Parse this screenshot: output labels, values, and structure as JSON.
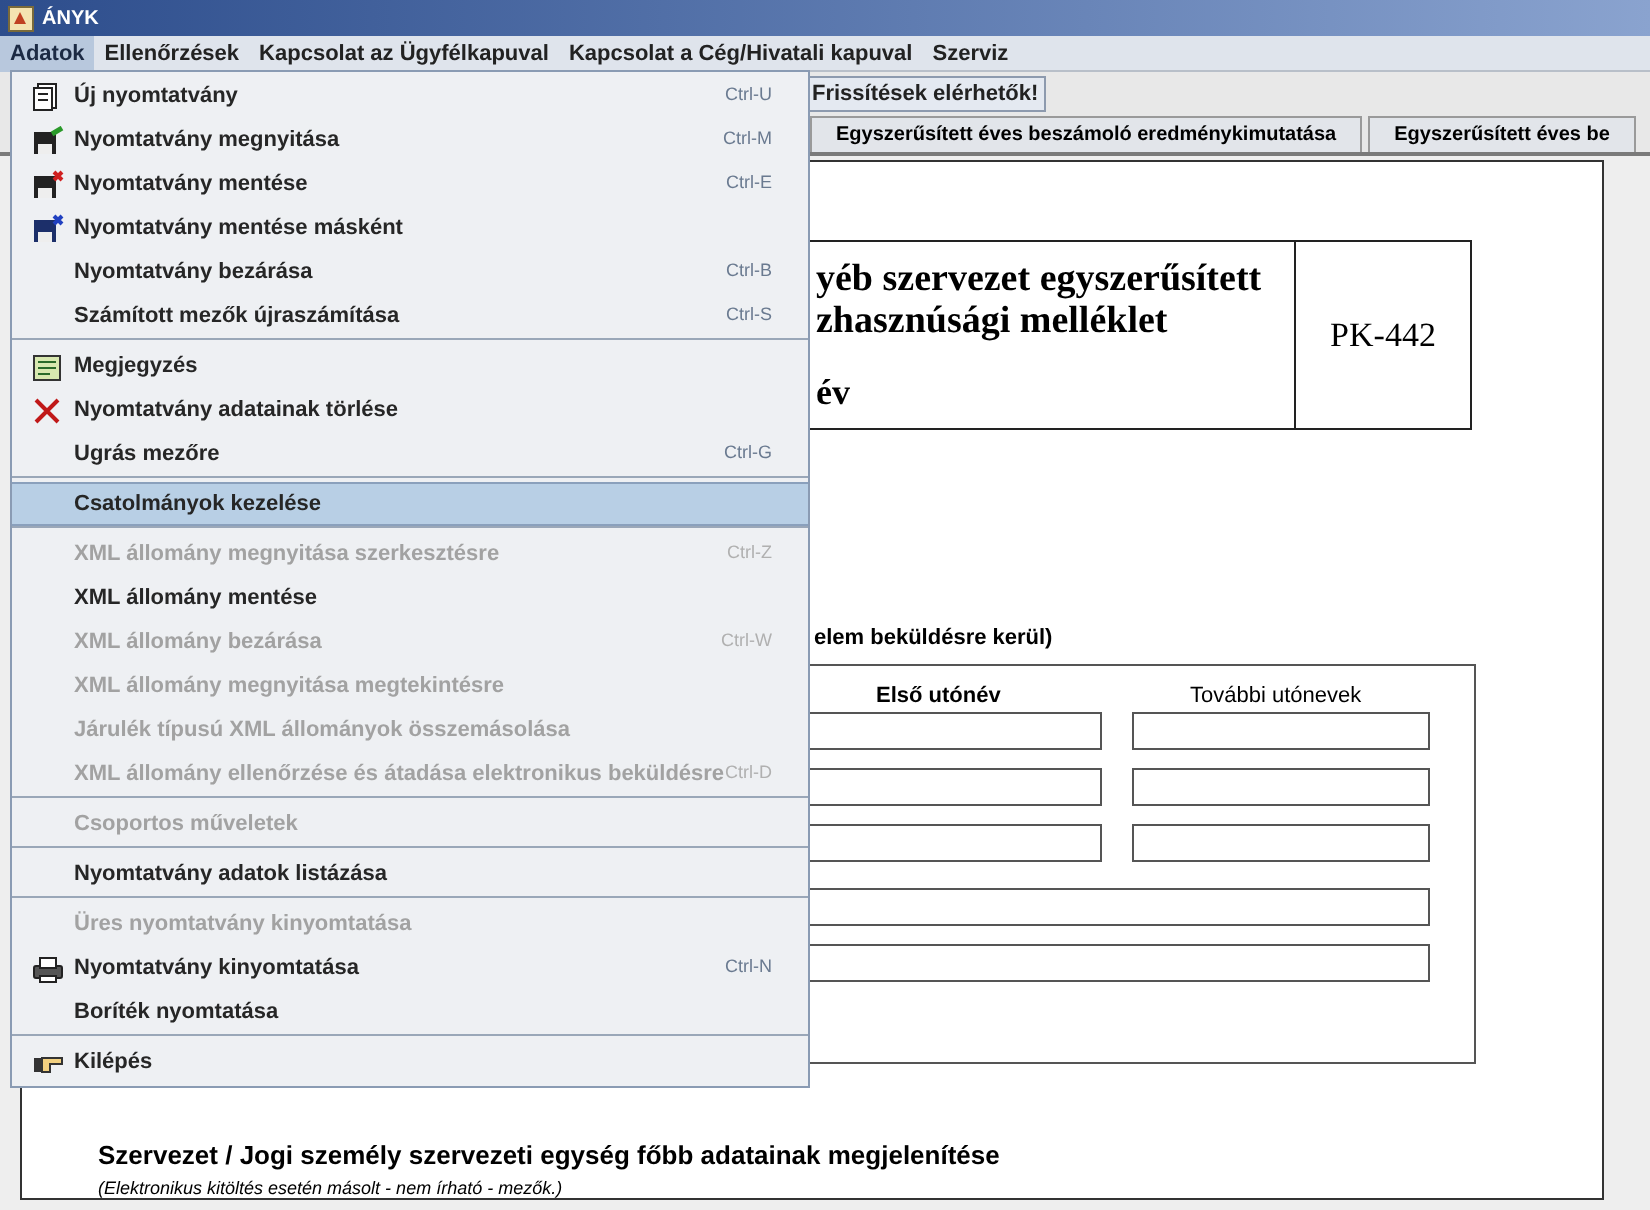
{
  "window": {
    "title": "ÁNYK"
  },
  "menu_bar": [
    {
      "label": "Adatok",
      "selected": true
    },
    {
      "label": "Ellenőrzések",
      "selected": false
    },
    {
      "label": "Kapcsolat az Ügyfélkapuval",
      "selected": false
    },
    {
      "label": "Kapcsolat a Cég/Hivatali kapuval",
      "selected": false
    },
    {
      "label": "Szerviz",
      "selected": false
    }
  ],
  "toolbar": {
    "update_button": "Frissítések elérhetők!"
  },
  "tabs": [
    {
      "label": "Egyszerűsített éves beszámoló eredménykimutatása",
      "selected": false
    },
    {
      "label": "Egyszerűsített éves be",
      "selected": false
    }
  ],
  "form": {
    "header_lines": [
      "yéb szervezet egyszerűsített",
      "zhasznúsági melléklet"
    ],
    "year_label": "év",
    "code": "PK-442",
    "section_note": "elem beküldésre kerül)",
    "name_columns": [
      {
        "label": "Első utónév",
        "emphasized": true
      },
      {
        "label": "További utónevek",
        "emphasized": false
      }
    ],
    "section_title": "Szervezet / Jogi személy szervezeti egység főbb adatainak megjelenítése",
    "section_subtitle": "(Elektronikus kitöltés esetén másolt - nem írható -  mezők.)"
  },
  "dropdown_menu": {
    "items": [
      {
        "kind": "item",
        "label": "Új nyomtatvány",
        "shortcut": "Ctrl-U",
        "disabled": false,
        "selected": false
      },
      {
        "kind": "item",
        "label": "Nyomtatvány megnyitása",
        "shortcut": "Ctrl-M",
        "disabled": false,
        "selected": false
      },
      {
        "kind": "item",
        "label": "Nyomtatvány mentése",
        "shortcut": "Ctrl-E",
        "disabled": false,
        "selected": false
      },
      {
        "kind": "item",
        "label": "Nyomtatvány mentése másként",
        "disabled": false,
        "selected": false
      },
      {
        "kind": "item",
        "label": "Nyomtatvány bezárása",
        "shortcut": "Ctrl-B",
        "disabled": false,
        "selected": false
      },
      {
        "kind": "item",
        "label": "Számított mezők újraszámítása",
        "shortcut": "Ctrl-S",
        "disabled": false,
        "selected": false
      },
      {
        "kind": "separator"
      },
      {
        "kind": "item",
        "label": "Megjegyzés",
        "disabled": false,
        "selected": false
      },
      {
        "kind": "item",
        "label": "Nyomtatvány adatainak törlése",
        "disabled": false,
        "selected": false
      },
      {
        "kind": "item",
        "label": "Ugrás mezőre",
        "shortcut": "Ctrl-G",
        "disabled": false,
        "selected": false
      },
      {
        "kind": "separator"
      },
      {
        "kind": "item",
        "label": "Csatolmányok kezelése",
        "disabled": false,
        "selected": true
      },
      {
        "kind": "separator"
      },
      {
        "kind": "item",
        "label": "XML állomány megnyitása szerkesztésre",
        "shortcut": "Ctrl-Z",
        "disabled": true,
        "selected": false
      },
      {
        "kind": "item",
        "label": "XML állomány mentése",
        "disabled": false,
        "selected": false
      },
      {
        "kind": "item",
        "label": "XML állomány bezárása",
        "shortcut": "Ctrl-W",
        "disabled": true,
        "selected": false
      },
      {
        "kind": "item",
        "label": "XML állomány megnyitása megtekintésre",
        "disabled": true,
        "selected": false
      },
      {
        "kind": "item",
        "label": "Járulék típusú XML állományok összemásolása",
        "disabled": true,
        "selected": false
      },
      {
        "kind": "item",
        "label": "XML állomány ellenőrzése és átadása elektronikus beküldésre",
        "shortcut": "Ctrl-D",
        "disabled": true,
        "selected": false
      },
      {
        "kind": "separator"
      },
      {
        "kind": "item",
        "label": "Csoportos műveletek",
        "disabled": true,
        "selected": false
      },
      {
        "kind": "separator"
      },
      {
        "kind": "item",
        "label": "Nyomtatvány adatok listázása",
        "disabled": false,
        "selected": false
      },
      {
        "kind": "separator"
      },
      {
        "kind": "item",
        "label": "Üres nyomtatvány kinyomtatása",
        "disabled": true,
        "selected": false
      },
      {
        "kind": "item",
        "label": "Nyomtatvány kinyomtatása",
        "shortcut": "Ctrl-N",
        "disabled": false,
        "selected": false
      },
      {
        "kind": "item",
        "label": "Boríték nyomtatása",
        "disabled": false,
        "selected": false
      },
      {
        "kind": "separator"
      },
      {
        "kind": "item",
        "label": "Kilépés",
        "disabled": false,
        "selected": false
      }
    ]
  }
}
